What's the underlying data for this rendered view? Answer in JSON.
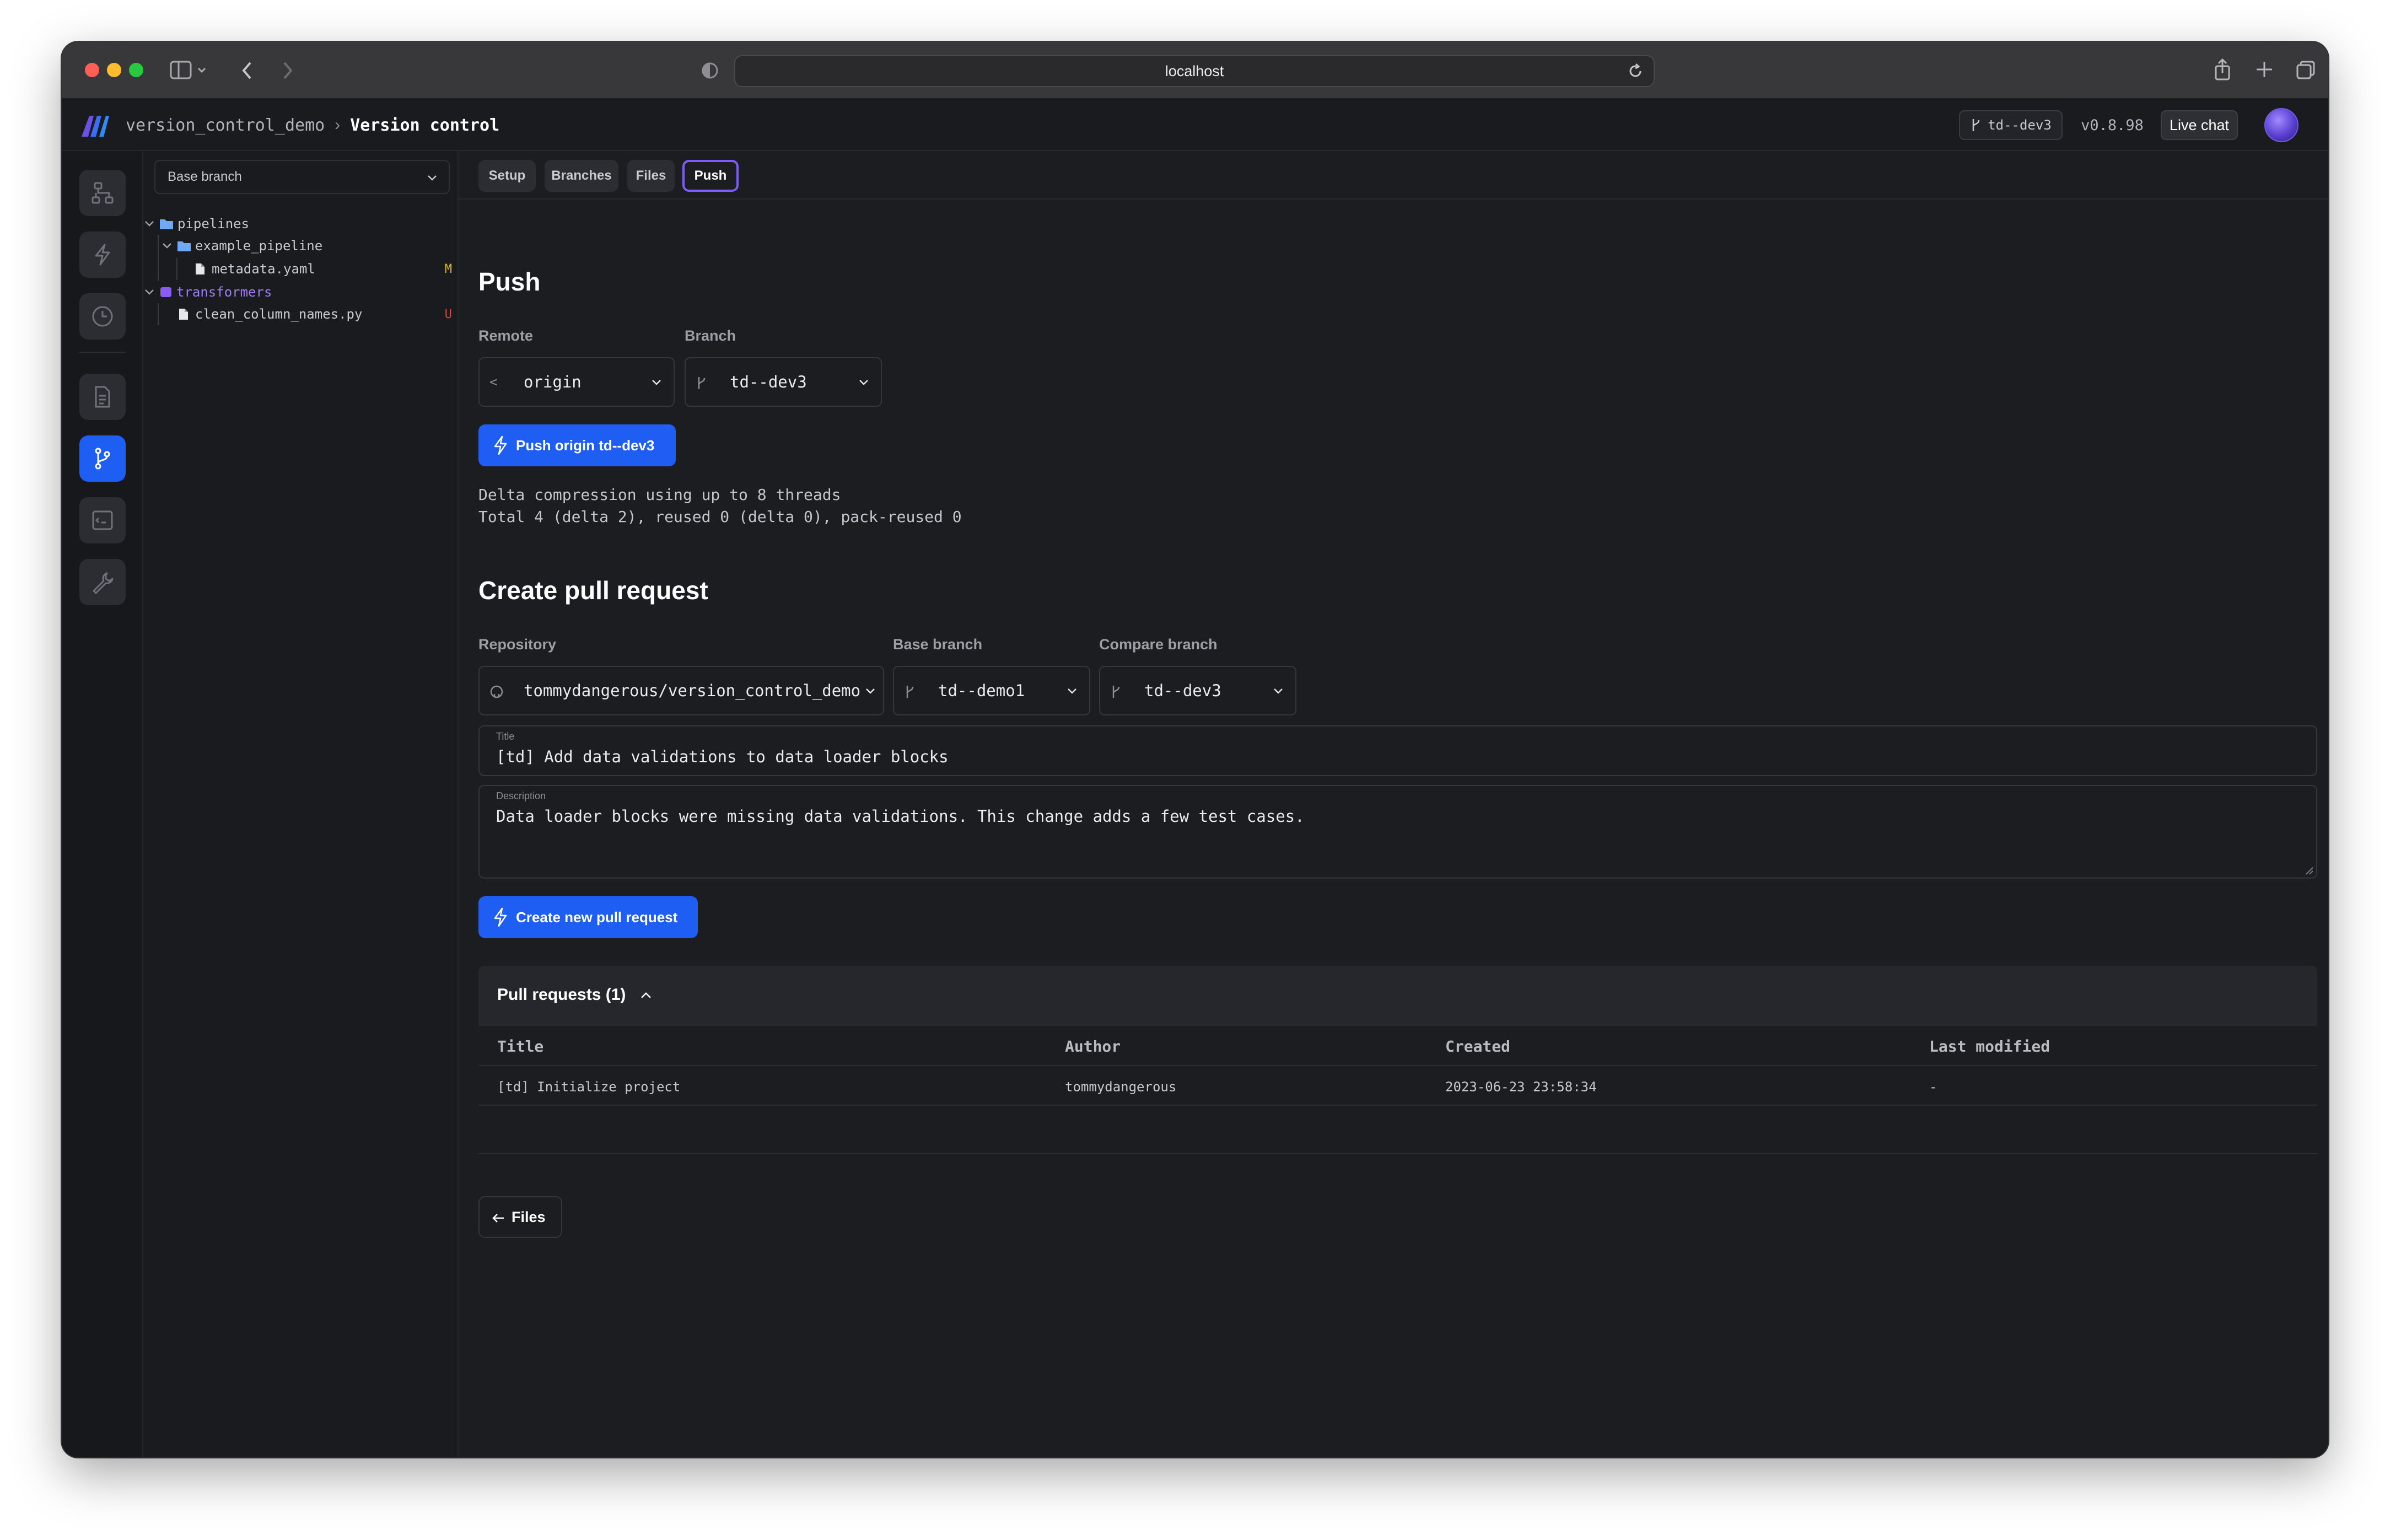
{
  "browser": {
    "url": "localhost",
    "traffic_lights": {
      "close": "#ff5f57",
      "minimize": "#febc2e",
      "maximize": "#28c840"
    }
  },
  "header": {
    "project": "version_control_demo",
    "separator": "›",
    "page": "Version control",
    "branch_badge": "td--dev3",
    "version": "v0.8.98",
    "live_chat": "Live chat"
  },
  "sidebar_tree": {
    "base_branch_label": "Base branch",
    "items": [
      {
        "name": "pipelines",
        "type": "folder"
      },
      {
        "name": "example_pipeline",
        "type": "folder"
      },
      {
        "name": "metadata.yaml",
        "type": "file",
        "status": "M"
      },
      {
        "name": "transformers",
        "type": "folder"
      },
      {
        "name": "clean_column_names.py",
        "type": "file",
        "status": "U"
      }
    ]
  },
  "tabs": [
    "Setup",
    "Branches",
    "Files",
    "Push"
  ],
  "push": {
    "title": "Push",
    "remote_label": "Remote",
    "remote_value": "origin",
    "branch_label": "Branch",
    "branch_value": "td--dev3",
    "button": "Push origin td--dev3",
    "log": [
      "Delta compression using up to 8 threads",
      "Total 4 (delta 2), reused 0 (delta 0), pack-reused 0"
    ]
  },
  "pull_request": {
    "title": "Create pull request",
    "repository_label": "Repository",
    "repository_value": "tommydangerous/version_control_demo",
    "base_label": "Base branch",
    "base_value": "td--demo1",
    "compare_label": "Compare branch",
    "compare_value": "td--dev3",
    "title_field_label": "Title",
    "title_field_value": "[td] Add data validations to data loader blocks",
    "description_label": "Description",
    "description_value": "Data loader blocks were missing data validations. This change adds a few test cases.",
    "button": "Create new pull request"
  },
  "pull_requests_table": {
    "header": "Pull requests (1)",
    "columns": [
      "Title",
      "Author",
      "Created",
      "Last modified"
    ],
    "rows": [
      [
        "[td] Initialize project",
        "tommydangerous",
        "2023-06-23 23:58:34",
        "-"
      ]
    ]
  },
  "footer": {
    "files_button": "Files"
  },
  "colors": {
    "accent": "#1f5ef2",
    "tab_active_border": "#7c5cff",
    "status_modified": "#e0b323",
    "status_untracked": "#e0453f"
  }
}
